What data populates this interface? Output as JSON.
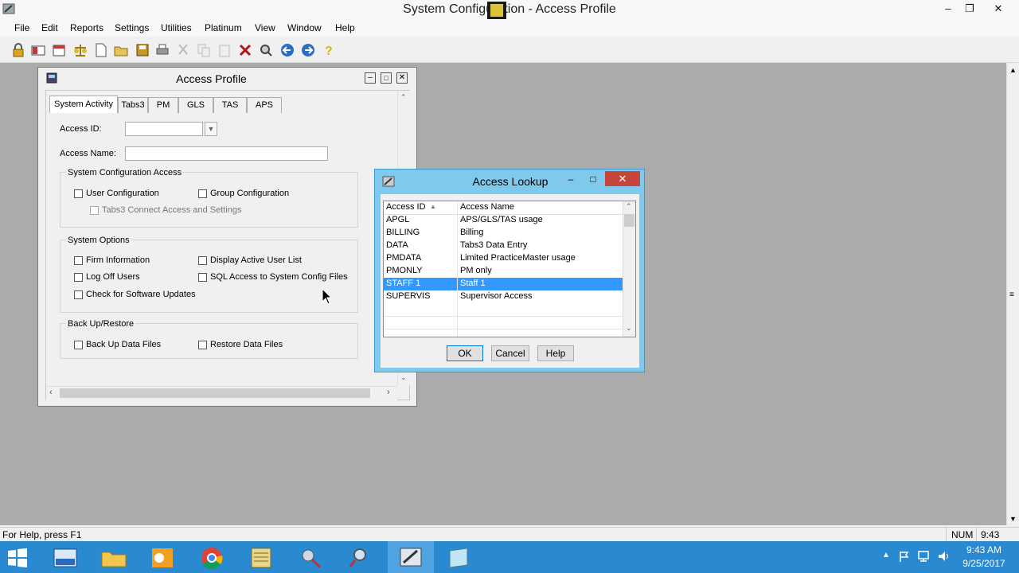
{
  "app": {
    "title": "System Configuration - Access Profile"
  },
  "menu": [
    "File",
    "Edit",
    "Reports",
    "Settings",
    "Utilities",
    "Platinum",
    "View",
    "Window",
    "Help"
  ],
  "toolbar": {
    "icons": [
      "lock-icon",
      "aid-icon",
      "calendar-icon",
      "scales-icon",
      "new-document-icon",
      "open-folder-icon",
      "save-icon",
      "print-icon",
      "cut-icon",
      "copy-icon",
      "paste-icon",
      "delete-icon",
      "find-icon",
      "back-arrow-icon",
      "forward-arrow-icon",
      "help-icon"
    ]
  },
  "child": {
    "title": "Access Profile",
    "tabs": [
      "System Activity",
      "Tabs3",
      "PM",
      "GLS",
      "TAS",
      "APS"
    ],
    "access_id_label": "Access ID:",
    "access_name_label": "Access Name:",
    "access_id_value": "",
    "access_name_value": "",
    "group_sysconfig": {
      "title": "System Configuration Access",
      "user_config": "User Configuration",
      "group_config": "Group Configuration",
      "tabs3_connect": "Tabs3 Connect Access and Settings"
    },
    "group_options": {
      "title": "System Options",
      "firm_info": "Firm Information",
      "display_active": "Display Active User List",
      "log_off": "Log Off Users",
      "sql_access": "SQL Access to System Config Files",
      "check_updates": "Check for Software Updates"
    },
    "group_backup": {
      "title": "Back Up/Restore",
      "backup": "Back Up Data Files",
      "restore": "Restore Data Files"
    }
  },
  "dialog": {
    "title": "Access Lookup",
    "col_id": "Access ID",
    "col_name": "Access Name",
    "rows": [
      {
        "id": "APGL",
        "name": "APS/GLS/TAS usage"
      },
      {
        "id": "BILLING",
        "name": "Billing"
      },
      {
        "id": "DATA",
        "name": "Tabs3 Data Entry"
      },
      {
        "id": "PMDATA",
        "name": "Limited PracticeMaster usage"
      },
      {
        "id": "PMONLY",
        "name": "PM only"
      },
      {
        "id": "STAFF 1",
        "name": "Staff 1"
      },
      {
        "id": "SUPERVIS",
        "name": "Supervisor Access"
      }
    ],
    "selected_row": "STAFF 1",
    "ok": "OK",
    "cancel": "Cancel",
    "help": "Help"
  },
  "status": {
    "help_text": "For Help, press F1",
    "num": "NUM",
    "time": "9:43"
  },
  "taskbar": {
    "time": "9:43 AM",
    "date": "9/25/2017"
  },
  "colors": {
    "selection": "#3399ff",
    "taskbar": "#2a8ad1",
    "dialog_border": "#7fc9ec",
    "mdi_bg": "#ababab"
  }
}
